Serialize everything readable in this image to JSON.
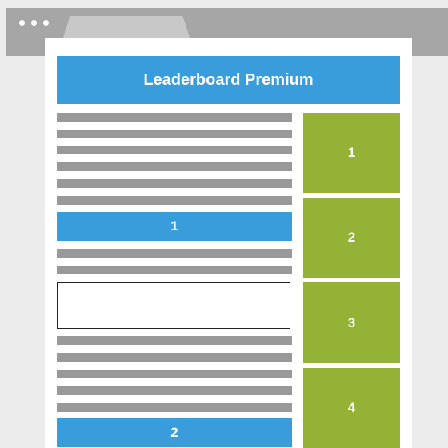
{
  "browser": {
    "window_dots": [
      "dot",
      "dot",
      "dot"
    ]
  },
  "leaderboard": {
    "label": "Leaderboard Premium"
  },
  "inline_ads": [
    {
      "label": "1"
    },
    {
      "label": "2"
    }
  ],
  "sidebar_ads": [
    {
      "label": "1"
    },
    {
      "label": "2"
    },
    {
      "label": "3"
    },
    {
      "label": "4"
    }
  ],
  "colors": {
    "ad_blue": "#3a9ddb",
    "ad_green": "#93b236",
    "text_placeholder_gray": "#999999",
    "chrome_gray": "#a6a6a6"
  }
}
